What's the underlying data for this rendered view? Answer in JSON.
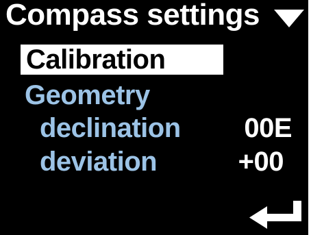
{
  "header": {
    "title": "Compass settings",
    "menu_icon": "triangle-down-icon"
  },
  "menu": {
    "items": [
      {
        "label": "Calibration",
        "selected": true
      },
      {
        "label": "Geometry",
        "selected": false
      }
    ],
    "sub_items": [
      {
        "label": "declination",
        "value": "00E"
      },
      {
        "label": "deviation",
        "value": "+00"
      }
    ]
  },
  "footer": {
    "enter_icon": "enter-return-icon"
  },
  "colors": {
    "background": "#000000",
    "foreground": "#ffffff",
    "accent": "#9cc3e6"
  }
}
